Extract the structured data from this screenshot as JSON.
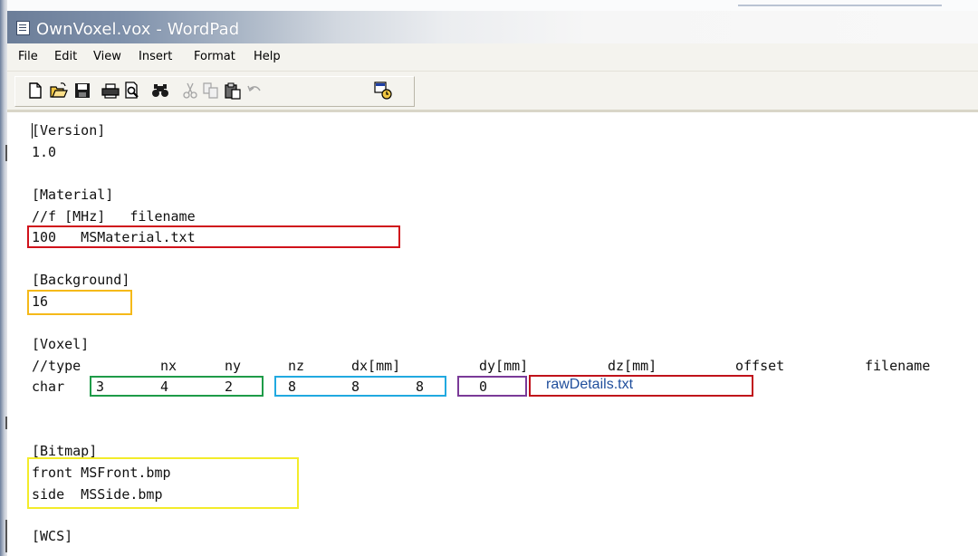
{
  "window": {
    "title": "OwnVoxel.vox - WordPad",
    "icon": "wordpad-document-icon"
  },
  "menu": [
    "File",
    "Edit",
    "View",
    "Insert",
    "Format",
    "Help"
  ],
  "toolbar": {
    "buttons": [
      "new-icon",
      "open-icon",
      "save-icon",
      "print-icon",
      "print-preview-icon",
      "find-icon",
      "cut-icon",
      "copy-icon",
      "paste-icon",
      "undo-icon",
      "date-time-icon"
    ]
  },
  "document": {
    "version_header": "[Version]",
    "version_value": "1.0",
    "material_header": "[Material]",
    "material_comment": "//f [MHz]   filename",
    "material_value": "100   MSMaterial.txt",
    "background_header": "[Background]",
    "background_value": "16",
    "voxel_header": "[Voxel]",
    "voxel_columns": [
      "//type",
      "nx",
      "ny",
      "nz",
      "dx[mm]",
      "dy[mm]",
      "dz[mm]",
      "offset",
      "filename"
    ],
    "voxel_row": {
      "type": "char",
      "nx": "3",
      "ny": "4",
      "nz": "2",
      "dx": "8",
      "dy": "8",
      "dz": "8",
      "offset": "0",
      "filename": "rawDetails.txt"
    },
    "bitmap_header": "[Bitmap]",
    "bitmap_front": "front MSFront.bmp",
    "bitmap_side": "side  MSSide.bmp",
    "wcs_header": "[WCS]"
  },
  "colors": {
    "annotation_red": "#d0121b",
    "annotation_orange": "#f5b919",
    "annotation_green": "#1e9b48",
    "annotation_cyan": "#21a9e0",
    "annotation_purple": "#7a3a98",
    "annotation_yellow": "#f3ec2a",
    "filename_text": "#1f4e9c"
  }
}
